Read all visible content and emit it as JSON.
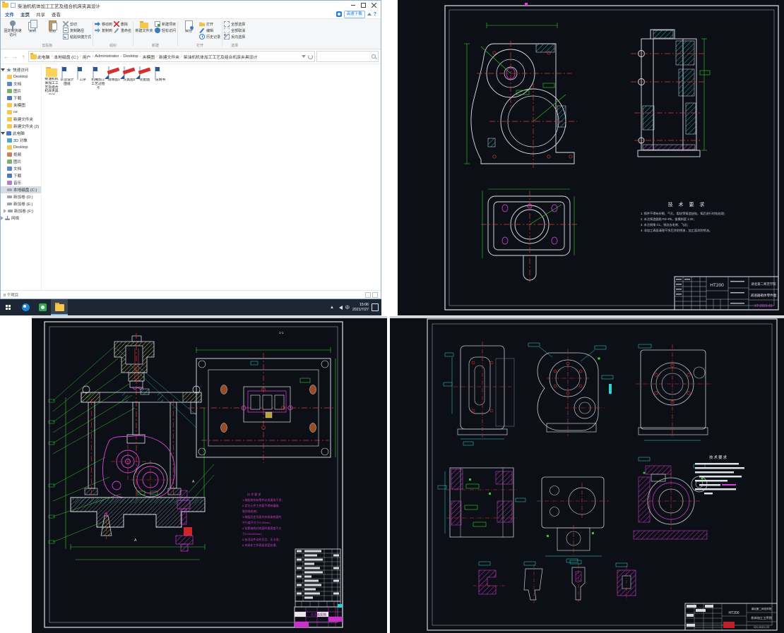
{
  "explorer": {
    "title": "柴油机机体加工工艺及组合机床夹具设计",
    "menu_tabs": [
      "文件",
      "主页",
      "共享",
      "查看"
    ],
    "promo": "高速下载",
    "ribbon": {
      "pin": "固定到快速访问",
      "copy": "复制",
      "paste": "粘贴",
      "cut": "剪切",
      "copy_path": "复制路径",
      "paste_shortcut": "粘贴快捷方式",
      "move_to": "移动到",
      "copy_to": "复制到",
      "del": "删除",
      "rename": "重命名",
      "new_folder": "新建文件夹",
      "new_item": "新建项目",
      "easy_access": "轻松访问",
      "props": "属性",
      "open": "打开",
      "edit": "编辑",
      "history": "历史记录",
      "sel_all": "全部选择",
      "sel_none": "全部取消",
      "sel_inv": "反向选择",
      "g_clip": "剪贴板",
      "g_org": "组织",
      "g_new": "新建",
      "g_open": "打开",
      "g_sel": "选择"
    },
    "breadcrumb": [
      "此电脑",
      "本地磁盘 (C:)",
      "用户",
      "Administrator",
      "Desktop",
      "夹模图",
      "新建文件夹",
      "柴油机机体加工工艺及组合机床夹具设计"
    ],
    "sidebar": {
      "quick_access": "快速访问",
      "qa_items": [
        "Desktop",
        "文档",
        "图片",
        "下载",
        "夹模图",
        "ce",
        "新建文件夹",
        "新建文件夹 (2)"
      ],
      "this_pc": "此电脑",
      "pc_items": [
        "3D 对象",
        "Desktop",
        "视频",
        "图片",
        "文档",
        "下载",
        "音乐",
        "本地磁盘 (C:)",
        "新加卷 (D:)",
        "新加卷 (E:)"
      ],
      "drive_f": "新加卷 (F:)",
      "network": "网络"
    },
    "files": [
      {
        "name": "柴油机机体加工工艺及组合机床夹具设计",
        "type": "folder"
      },
      {
        "name": "毕业设计图纸",
        "type": "doc"
      },
      {
        "name": "工序",
        "type": "doc"
      },
      {
        "name": "机械加工工艺过程卡",
        "type": "doc"
      },
      {
        "name": "箱体图1",
        "type": "cad"
      },
      {
        "name": "夹具图2",
        "type": "cad"
      },
      {
        "name": "装配图",
        "type": "cad"
      },
      {
        "name": "说明书",
        "type": "doc"
      }
    ],
    "status": "8 个项目"
  },
  "taskbar": {
    "time": "15:06",
    "date": "2021/7/27",
    "ime": "中"
  },
  "cad1": {
    "tech_title": "技 术 要 求",
    "tech_lines": [
      "1. 铸件不得有砂眼、气孔、裂纹等铸造缺陷，铸后进行时效处理；",
      "2. 未注铸造圆角 R3~R5，拔模斜度 1:20；",
      "3. 未注倒角 C1，锐边去毛刺、飞边；",
      "4. 非加工表面清理干净后涂防锈漆，加工面涂防锈油。"
    ],
    "material": "HT200",
    "school": "湖北第二师范学院",
    "drawing": "减速器箱体零件图",
    "number": "XT-2021-01"
  },
  "cad2": {
    "section_label": "1-1",
    "view_label": "A",
    "tech_lines": [
      "技 术 要 求",
      "1.装配前所有零件必须清洗干净；",
      "2.定位元件工作面不得有磕碰、",
      "  划伤和毛刺；",
      "3.装配后定位面对夹具体底面的",
      "  平行度不大于0.02mm；",
      "4.钻套轴线对底面的垂直度不大",
      "  于0.02/100mm；",
      "5.各活动件动作灵活、无卡滞；",
      "6.夹具非工作表面发蓝处理。"
    ],
    "title": "夹具装配图"
  },
  "cad3": {
    "note_title": "技术要求",
    "material": "HT200",
    "school": "湖北第二师范学院",
    "drawing": "机体加工工序图",
    "number": "GX-2021-03"
  }
}
